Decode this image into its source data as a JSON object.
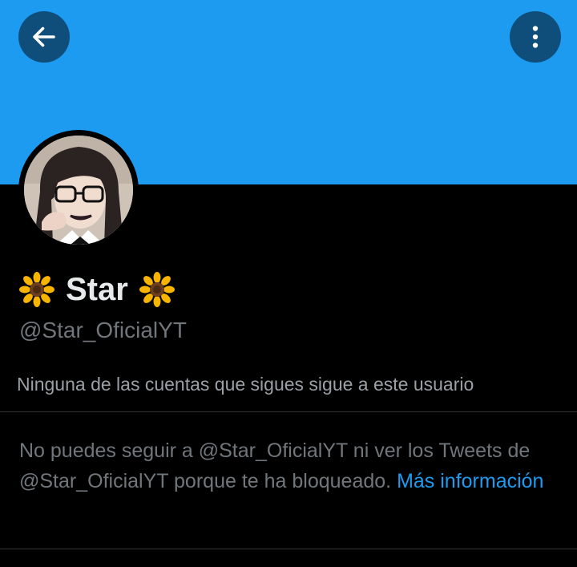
{
  "header": {
    "back_icon": "arrow-left-icon",
    "more_icon": "vertical-ellipsis-icon",
    "banner_color": "#1d9bf0",
    "button_color": "#0f4e7a"
  },
  "profile": {
    "avatar": "profile-photo",
    "name_prefix_emoji": "sunflower",
    "name": "Star",
    "name_suffix_emoji": "sunflower",
    "handle": "@Star_OficialYT",
    "followers_you_know": "Ninguna de las cuentas que sigues sigue a este usuario"
  },
  "blocked_notice": {
    "text": "No puedes seguir a @Star_OficialYT ni ver los Tweets de @Star_OficialYT porque te ha bloqueado.",
    "link_label": "Más información",
    "link_color": "#1d9bf0"
  }
}
